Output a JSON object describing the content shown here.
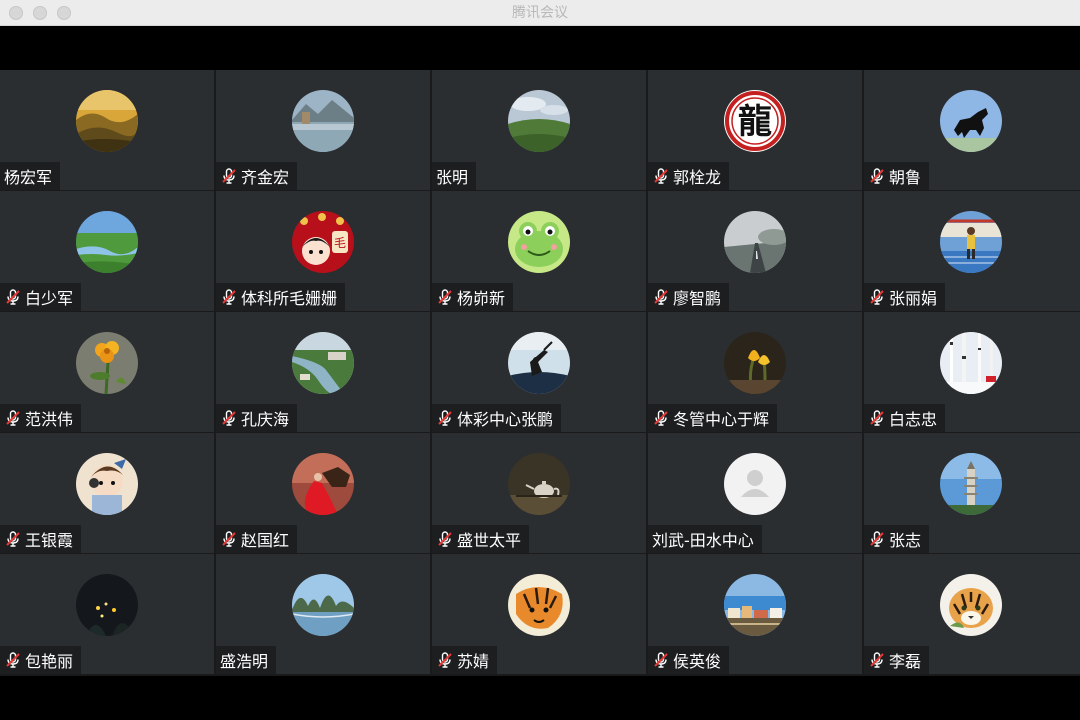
{
  "window": {
    "title": "腾讯会议"
  },
  "participants": [
    {
      "name": "杨宏军",
      "muted": false,
      "avatar": "golden-hills-landscape"
    },
    {
      "name": "齐金宏",
      "muted": true,
      "avatar": "lake-mountain-landscape"
    },
    {
      "name": "张明",
      "muted": false,
      "avatar": "green-meadow-sky"
    },
    {
      "name": "郭栓龙",
      "muted": true,
      "avatar": "dragon-calligraphy-seal"
    },
    {
      "name": "朝鲁",
      "muted": true,
      "avatar": "black-horse-blue-sky"
    },
    {
      "name": "白少军",
      "muted": true,
      "avatar": "grassland-river"
    },
    {
      "name": "体科所毛姗姗",
      "muted": true,
      "avatar": "cartoon-girl-red-lanterns"
    },
    {
      "name": "杨峁新",
      "muted": true,
      "avatar": "cartoon-frog"
    },
    {
      "name": "廖智鹏",
      "muted": true,
      "avatar": "misty-road"
    },
    {
      "name": "张丽娟",
      "muted": true,
      "avatar": "runner-on-track"
    },
    {
      "name": "范洪伟",
      "muted": true,
      "avatar": "yellow-flower"
    },
    {
      "name": "孔庆海",
      "muted": true,
      "avatar": "river-aerial-view"
    },
    {
      "name": "体彩中心张鹏",
      "muted": true,
      "avatar": "silhouette-sitting"
    },
    {
      "name": "冬管中心于辉",
      "muted": true,
      "avatar": "yellow-tulips"
    },
    {
      "name": "白志忠",
      "muted": true,
      "avatar": "snow-birch-forest"
    },
    {
      "name": "王银霞",
      "muted": true,
      "avatar": "cartoon-baby"
    },
    {
      "name": "赵国红",
      "muted": true,
      "avatar": "woman-red-dress-horse"
    },
    {
      "name": "盛世太平",
      "muted": true,
      "avatar": "teapot-still-life"
    },
    {
      "name": "刘武-田水中心",
      "muted": false,
      "avatar": "default-person"
    },
    {
      "name": "张志",
      "muted": true,
      "avatar": "pagoda-tower"
    },
    {
      "name": "包艳丽",
      "muted": true,
      "avatar": "night-lights"
    },
    {
      "name": "盛浩明",
      "muted": false,
      "avatar": "karst-mountains-lake"
    },
    {
      "name": "苏婧",
      "muted": true,
      "avatar": "tiger-painting"
    },
    {
      "name": "侯英俊",
      "muted": true,
      "avatar": "coastal-town"
    },
    {
      "name": "李磊",
      "muted": true,
      "avatar": "tiger-illustration"
    }
  ]
}
